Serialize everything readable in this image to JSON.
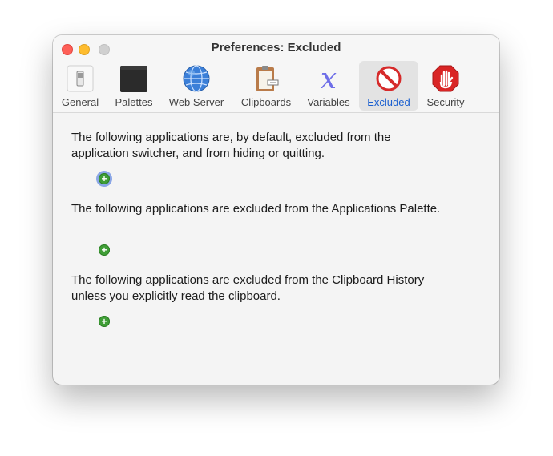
{
  "window": {
    "title": "Preferences: Excluded"
  },
  "toolbar": {
    "tabs": [
      {
        "label": "General",
        "icon": "switch-icon"
      },
      {
        "label": "Palettes",
        "icon": "palette-icon"
      },
      {
        "label": "Web Server",
        "icon": "globe-icon"
      },
      {
        "label": "Clipboards",
        "icon": "clipboard-icon"
      },
      {
        "label": "Variables",
        "icon": "variable-x-icon"
      },
      {
        "label": "Excluded",
        "icon": "no-entry-icon",
        "selected": true
      },
      {
        "label": "Security",
        "icon": "stop-hand-icon"
      }
    ]
  },
  "sections": [
    {
      "text_line1": "The following applications are, by default, excluded from the",
      "text_line2": "application switcher, and from hiding or quitting.",
      "add_label": "+"
    },
    {
      "text_line1": "The following applications are excluded from the Applications Palette.",
      "add_label": "+"
    },
    {
      "text_line1": "The following applications are excluded from the Clipboard History",
      "text_line2": "unless you explicitly read the clipboard.",
      "add_label": "+"
    }
  ],
  "colors": {
    "accent": "#1a5fd0",
    "add_button": "#3f9e36"
  }
}
